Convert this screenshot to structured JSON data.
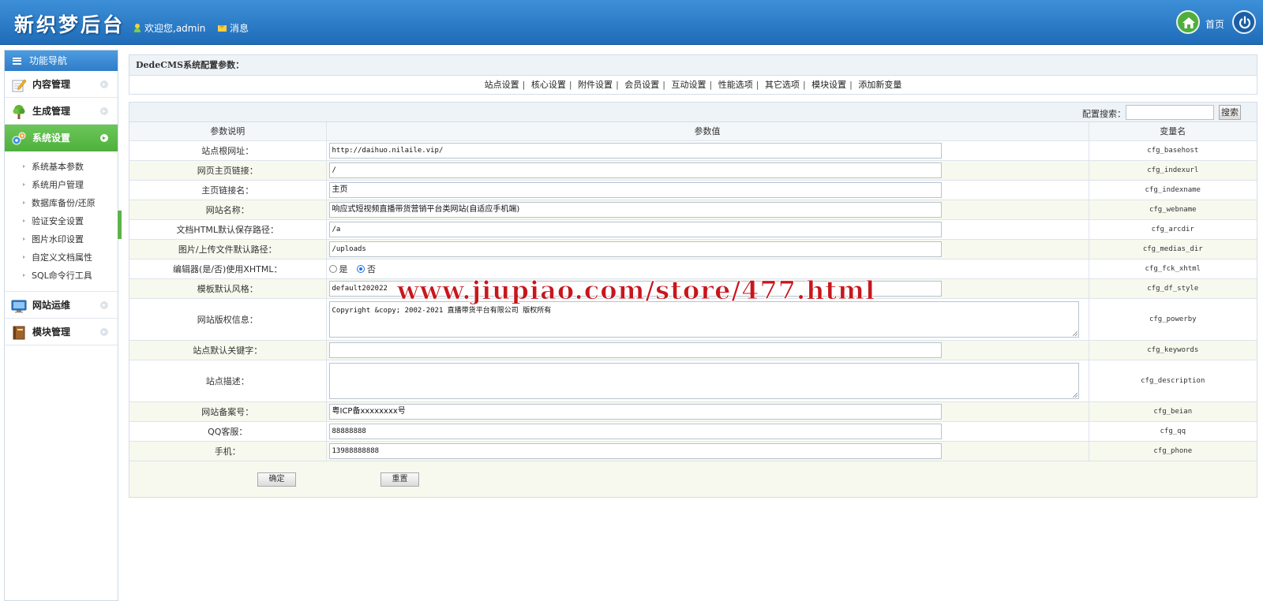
{
  "header": {
    "logo": "新织梦后台",
    "welcome": "欢迎您,admin",
    "message": "消息",
    "home": "首页"
  },
  "sidebar": {
    "title": "功能导航",
    "items": [
      {
        "label": "内容管理",
        "icon": "pencil-note-icon"
      },
      {
        "label": "生成管理",
        "icon": "tree-icon"
      },
      {
        "label": "系统设置",
        "icon": "gears-icon"
      },
      {
        "label": "网站运维",
        "icon": "monitor-icon"
      },
      {
        "label": "模块管理",
        "icon": "book-icon"
      }
    ],
    "sub_items": [
      "系统基本参数",
      "系统用户管理",
      "数据库备份/还原",
      "验证安全设置",
      "图片水印设置",
      "自定义文档属性",
      "SQL命令行工具"
    ]
  },
  "panel": {
    "title": "DedeCMS系统配置参数：",
    "tabs": [
      "站点设置",
      "核心设置",
      "附件设置",
      "会员设置",
      "互动设置",
      "性能选项",
      "其它选项",
      "模块设置",
      "添加新变量"
    ]
  },
  "search": {
    "label": "配置搜索：",
    "button": "搜索"
  },
  "table": {
    "headers": [
      "参数说明",
      "参数值",
      "变量名"
    ],
    "rows": [
      {
        "label": "站点根网址：",
        "value": "http://daihuo.nilaile.vip/",
        "var": "cfg_basehost"
      },
      {
        "label": "网页主页链接：",
        "value": "/",
        "var": "cfg_indexurl"
      },
      {
        "label": "主页链接名：",
        "value": "主页",
        "var": "cfg_indexname"
      },
      {
        "label": "网站名称：",
        "value": "响应式短视频直播带货营销平台类网站(自适应手机端)",
        "var": "cfg_webname"
      },
      {
        "label": "文档HTML默认保存路径：",
        "value": "/a",
        "var": "cfg_arcdir"
      },
      {
        "label": "图片/上传文件默认路径：",
        "value": "/uploads",
        "var": "cfg_medias_dir"
      },
      {
        "label": "编辑器(是/否)使用XHTML：",
        "radio_yes": "是",
        "radio_no": "否",
        "var": "cfg_fck_xhtml"
      },
      {
        "label": "模板默认风格：",
        "value": "default202022",
        "var": "cfg_df_style"
      },
      {
        "label": "网站版权信息：",
        "value": "Copyright &copy; 2002-2021 直播带货平台有限公司 版权所有",
        "var": "cfg_powerby"
      },
      {
        "label": "站点默认关键字：",
        "value": "",
        "var": "cfg_keywords"
      },
      {
        "label": "站点描述：",
        "value": "",
        "var": "cfg_description"
      },
      {
        "label": "网站备案号：",
        "value": "粤ICP备xxxxxxxx号",
        "var": "cfg_beian"
      },
      {
        "label": "QQ客服：",
        "value": "88888888",
        "var": "cfg_qq"
      },
      {
        "label": "手机：",
        "value": "13988888888",
        "var": "cfg_phone"
      }
    ]
  },
  "buttons": {
    "confirm": "确定",
    "reset": "重置"
  },
  "watermark": "www.jiupiao.com/store/477.html",
  "colors": {
    "header_blue": "#2a7ac6",
    "active_green": "#55b441",
    "watermark_red": "#c8161d"
  }
}
